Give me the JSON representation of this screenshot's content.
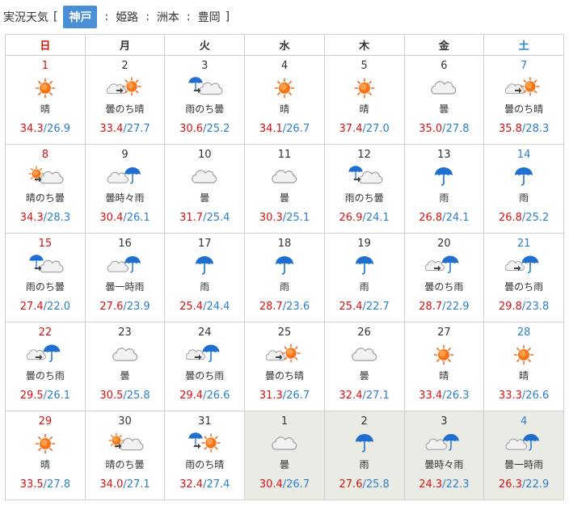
{
  "header": {
    "title": "実況天気",
    "bracket_open": "[",
    "bracket_close": "]",
    "separator": ":",
    "active_area": "神戸",
    "areas": [
      "姫路",
      "洲本",
      "豊岡"
    ]
  },
  "weekdays": [
    "日",
    "月",
    "火",
    "水",
    "木",
    "金",
    "土"
  ],
  "temp_separator": "/",
  "colors": {
    "accent": "#4a8ed6",
    "high": "#dd1111",
    "low": "#2a7fcf",
    "next_month_bg": "#ebebe5"
  },
  "weeks": [
    [
      {
        "day": "1",
        "weather": "晴",
        "icon": "sun-icon",
        "high": "34.3",
        "low": "26.9"
      },
      {
        "day": "2",
        "weather": "曇のち晴",
        "icon": "cloud-then-sun-icon",
        "high": "33.4",
        "low": "27.7"
      },
      {
        "day": "3",
        "weather": "雨のち曇",
        "icon": "rain-then-cloud-icon",
        "high": "30.6",
        "low": "25.2"
      },
      {
        "day": "4",
        "weather": "晴",
        "icon": "sun-icon",
        "high": "34.1",
        "low": "26.7"
      },
      {
        "day": "5",
        "weather": "晴",
        "icon": "sun-icon",
        "high": "37.4",
        "low": "27.0"
      },
      {
        "day": "6",
        "weather": "曇",
        "icon": "cloud-icon",
        "high": "35.0",
        "low": "27.8"
      },
      {
        "day": "7",
        "weather": "曇のち晴",
        "icon": "cloud-then-sun-icon",
        "high": "35.8",
        "low": "28.3"
      }
    ],
    [
      {
        "day": "8",
        "weather": "晴のち曇",
        "icon": "sun-then-cloud-icon",
        "high": "34.3",
        "low": "28.3"
      },
      {
        "day": "9",
        "weather": "曇時々雨",
        "icon": "cloud-sometimes-rain-icon",
        "high": "30.4",
        "low": "26.1"
      },
      {
        "day": "10",
        "weather": "曇",
        "icon": "cloud-icon",
        "high": "31.7",
        "low": "25.4"
      },
      {
        "day": "11",
        "weather": "曇",
        "icon": "cloud-icon",
        "high": "30.3",
        "low": "25.1"
      },
      {
        "day": "12",
        "weather": "雨のち曇",
        "icon": "rain-then-cloud-icon",
        "high": "26.9",
        "low": "24.1"
      },
      {
        "day": "13",
        "weather": "雨",
        "icon": "rain-icon",
        "high": "26.8",
        "low": "24.1"
      },
      {
        "day": "14",
        "weather": "雨",
        "icon": "rain-icon",
        "high": "26.8",
        "low": "25.2"
      }
    ],
    [
      {
        "day": "15",
        "weather": "雨のち曇",
        "icon": "rain-then-cloud-icon",
        "high": "27.4",
        "low": "22.0"
      },
      {
        "day": "16",
        "weather": "曇一時雨",
        "icon": "cloud-sometimes-rain-icon",
        "high": "27.6",
        "low": "23.9"
      },
      {
        "day": "17",
        "weather": "雨",
        "icon": "rain-icon",
        "high": "25.4",
        "low": "24.4"
      },
      {
        "day": "18",
        "weather": "雨",
        "icon": "rain-icon",
        "high": "28.7",
        "low": "23.6"
      },
      {
        "day": "19",
        "weather": "雨",
        "icon": "rain-icon",
        "high": "25.4",
        "low": "22.7"
      },
      {
        "day": "20",
        "weather": "曇のち雨",
        "icon": "cloud-then-rain-icon",
        "high": "28.7",
        "low": "22.9"
      },
      {
        "day": "21",
        "weather": "曇のち雨",
        "icon": "cloud-then-rain-icon",
        "high": "29.8",
        "low": "23.8"
      }
    ],
    [
      {
        "day": "22",
        "weather": "曇のち雨",
        "icon": "cloud-then-rain-icon",
        "high": "29.5",
        "low": "26.1"
      },
      {
        "day": "23",
        "weather": "曇",
        "icon": "cloud-icon",
        "high": "30.5",
        "low": "25.8"
      },
      {
        "day": "24",
        "weather": "曇のち雨",
        "icon": "cloud-then-rain-icon",
        "high": "29.4",
        "low": "26.6"
      },
      {
        "day": "25",
        "weather": "曇のち晴",
        "icon": "cloud-then-sun-icon",
        "high": "31.3",
        "low": "26.7"
      },
      {
        "day": "26",
        "weather": "曇",
        "icon": "cloud-icon",
        "high": "32.4",
        "low": "27.1"
      },
      {
        "day": "27",
        "weather": "晴",
        "icon": "sun-icon",
        "high": "33.4",
        "low": "26.3"
      },
      {
        "day": "28",
        "weather": "晴",
        "icon": "sun-icon",
        "high": "33.3",
        "low": "26.6"
      }
    ],
    [
      {
        "day": "29",
        "weather": "晴",
        "icon": "sun-icon",
        "high": "33.5",
        "low": "27.8"
      },
      {
        "day": "30",
        "weather": "晴のち曇",
        "icon": "sun-then-cloud-icon",
        "high": "34.0",
        "low": "27.1"
      },
      {
        "day": "31",
        "weather": "雨のち晴",
        "icon": "rain-then-sun-icon",
        "high": "32.4",
        "low": "27.4"
      },
      {
        "day": "1",
        "weather": "曇",
        "icon": "cloud-icon",
        "high": "30.4",
        "low": "26.7",
        "next": true
      },
      {
        "day": "2",
        "weather": "雨",
        "icon": "rain-icon",
        "high": "27.6",
        "low": "25.8",
        "next": true
      },
      {
        "day": "3",
        "weather": "曇時々雨",
        "icon": "cloud-sometimes-rain-icon",
        "high": "24.3",
        "low": "22.3",
        "next": true
      },
      {
        "day": "4",
        "weather": "曇一時雨",
        "icon": "cloud-sometimes-rain-icon",
        "high": "26.3",
        "low": "22.9",
        "next": true
      }
    ]
  ]
}
